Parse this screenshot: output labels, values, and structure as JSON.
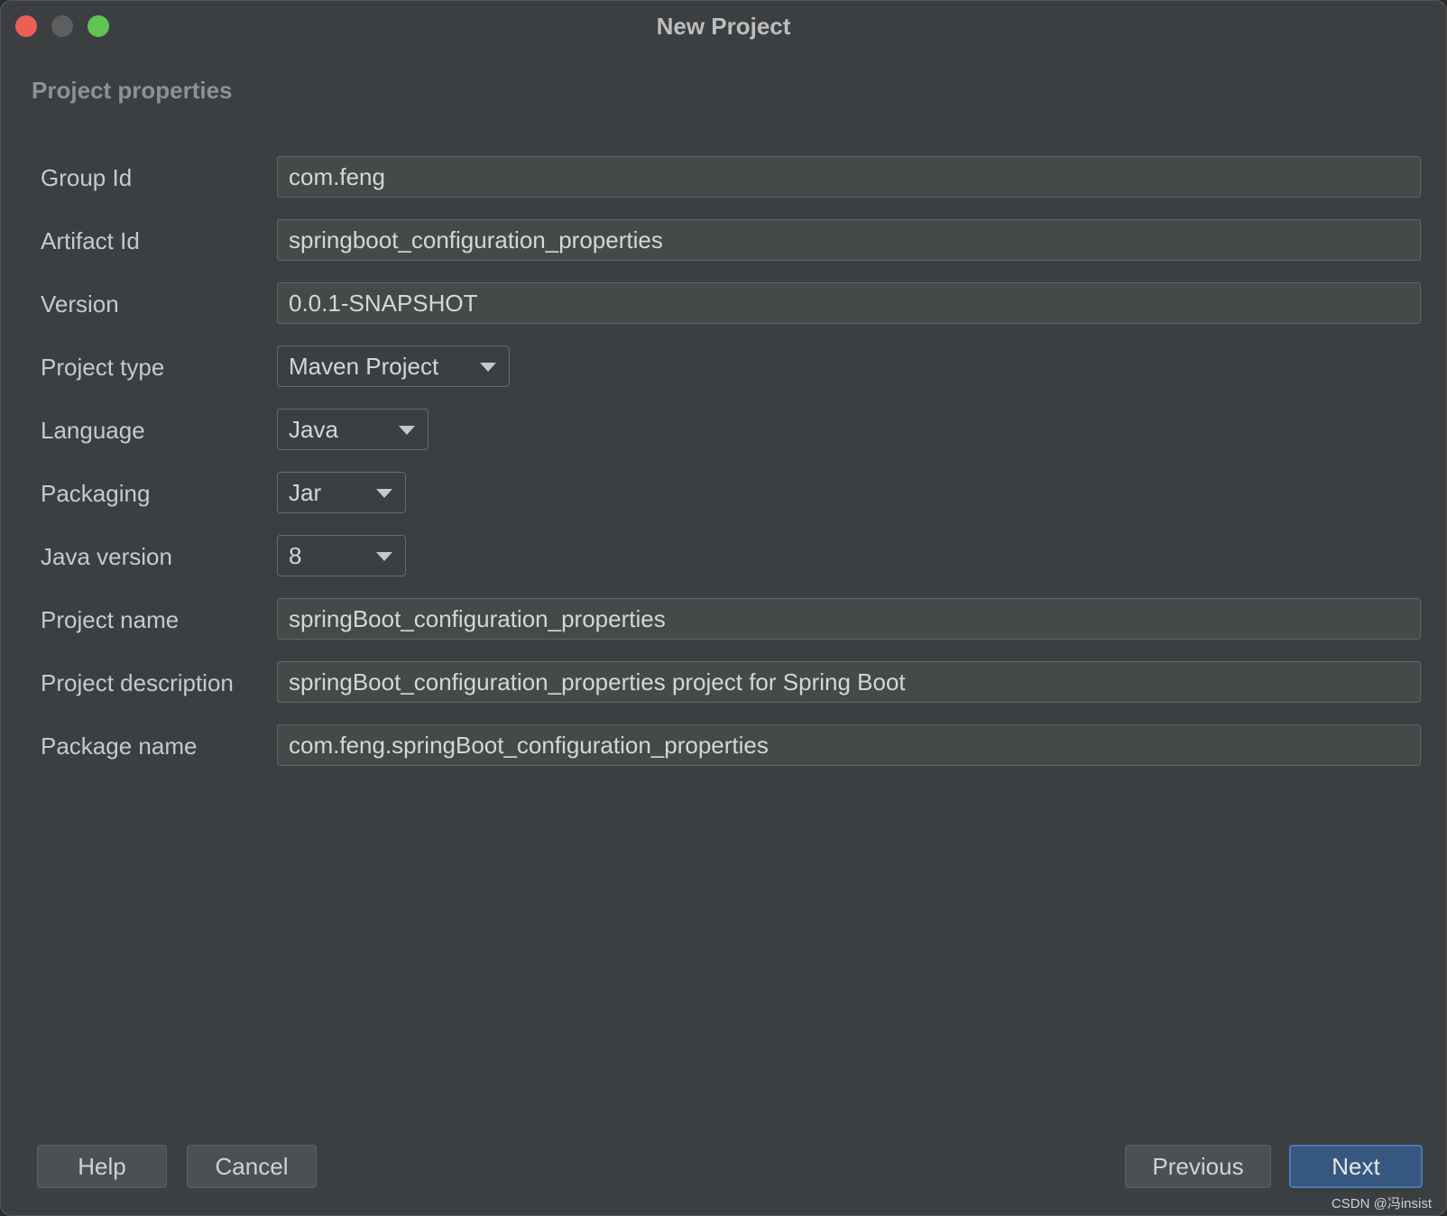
{
  "window": {
    "title": "New Project"
  },
  "section_title": "Project properties",
  "fields": {
    "group_id": {
      "label": "Group Id",
      "value": "com.feng"
    },
    "artifact_id": {
      "label": "Artifact Id",
      "value": "springboot_configuration_properties"
    },
    "version": {
      "label": "Version",
      "value": "0.0.1-SNAPSHOT"
    },
    "project_type": {
      "label": "Project type",
      "value": "Maven Project"
    },
    "language": {
      "label": "Language",
      "value": "Java"
    },
    "packaging": {
      "label": "Packaging",
      "value": "Jar"
    },
    "java_version": {
      "label": "Java version",
      "value": "8"
    },
    "project_name": {
      "label": "Project name",
      "value": "springBoot_configuration_properties"
    },
    "project_description": {
      "label": "Project description",
      "value": "springBoot_configuration_properties project for Spring Boot"
    },
    "package_name": {
      "label": "Package name",
      "value": "com.feng.springBoot_configuration_properties"
    }
  },
  "buttons": {
    "help": "Help",
    "cancel": "Cancel",
    "previous": "Previous",
    "next": "Next"
  },
  "watermark": "CSDN @冯insist",
  "colors": {
    "window_bg": "#3c3f41",
    "field_bg": "#45494a",
    "primary_button": "#365880",
    "close_light": "#ec5f57",
    "zoom_light": "#5fc454"
  }
}
